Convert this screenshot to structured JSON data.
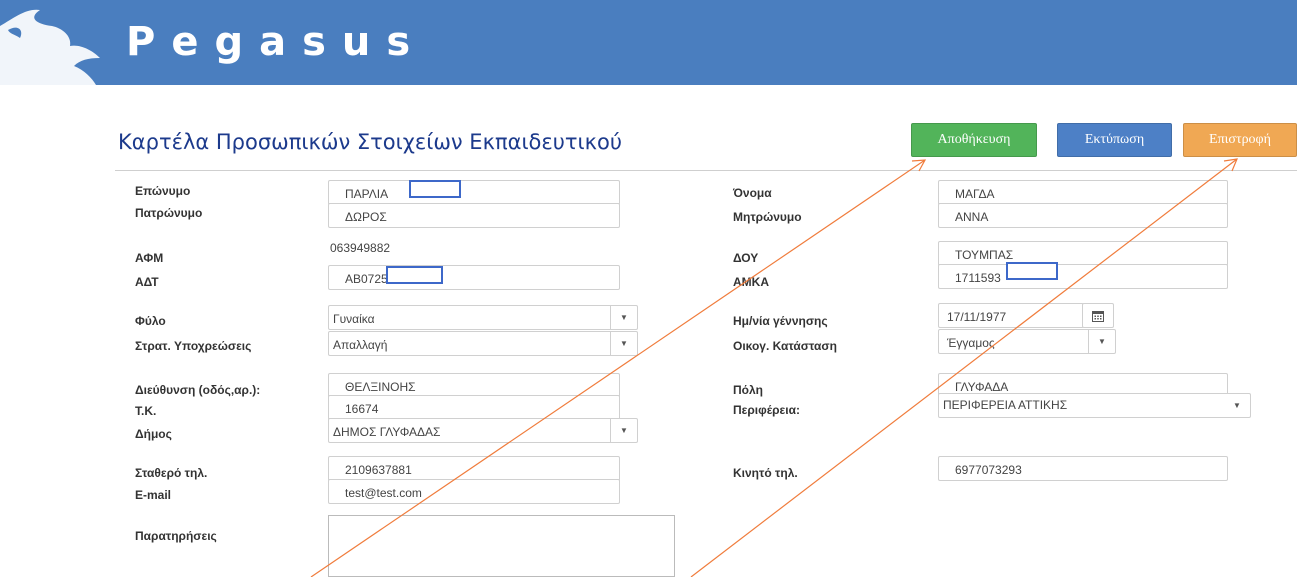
{
  "app": {
    "title": "Pegasus"
  },
  "page": {
    "title": "Καρτέλα Προσωπικών Στοιχείων Εκπαιδευτικού"
  },
  "toolbar": {
    "save_label": "Αποθήκευση",
    "print_label": "Εκτύπωση",
    "back_label": "Επιστροφή"
  },
  "labels": {
    "surname": "Επώνυμο",
    "father_name": "Πατρώνυμο",
    "afm": "ΑΦΜ",
    "adt": "ΑΔΤ",
    "gender": "Φύλο",
    "military": "Στρατ. Υποχρεώσεις",
    "address": "Διεύθυνση (οδός,αρ.):",
    "postal": "Τ.Κ.",
    "municipality": "Δήμος",
    "landline": "Σταθερό τηλ.",
    "email": "E-mail",
    "notes": "Παρατηρήσεις",
    "first_name": "Όνομα",
    "mother_name": "Μητρώνυμο",
    "doy": "ΔΟΥ",
    "amka": "ΑΜΚΑ",
    "birthdate": "Ημ/νία γέννησης",
    "marital": "Οικογ. Κατάσταση",
    "city": "Πόλη",
    "region": "Περιφέρεια:",
    "mobile": "Κινητό τηλ."
  },
  "values": {
    "surname": "ΠΑΡΛΙΑ",
    "father_name": "ΔΩΡΟΣ",
    "afm": "063949882",
    "adt": "ΑΒ0725",
    "gender": "Γυναίκα",
    "military": "Απαλλαγή",
    "address": "ΘΕΛΞΙΝΟΗΣ",
    "postal": "16674",
    "municipality": "ΔΗΜΟΣ ΓΛΥΦΑΔΑΣ",
    "landline": "2109637881",
    "email": "test@test.com",
    "notes": "",
    "first_name": "ΜΑΓΔΑ",
    "mother_name": "ΑΝΝΑ",
    "doy": "ΤΟΥΜΠΑΣ",
    "amka": "1711593",
    "birthdate": "17/11/1977",
    "marital": "Έγγαμος",
    "city": "ΓΛΥΦΑΔΑ",
    "region": "ΠΕΡΙΦΕΡΕΙΑ ΑΤΤΙΚΗΣ",
    "mobile": "6977073293"
  },
  "colors": {
    "header": "#4a7ebf",
    "save": "#52b45a",
    "print": "#4d80c6",
    "back": "#f0a854",
    "annotation_arrow": "#f07c3c",
    "redaction": "#3d68c9"
  },
  "icons": {
    "logo": "pegasus-logo-icon",
    "calendar": "calendar-icon",
    "dropdown": "chevron-down-icon"
  }
}
